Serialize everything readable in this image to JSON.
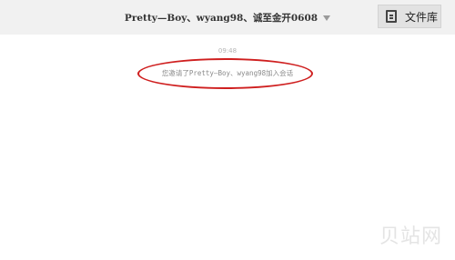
{
  "header": {
    "chat_title": "Pretty—Boy、wyang98、诚至金开0608",
    "files_button_label": "文件库"
  },
  "conversation": {
    "timestamp": "09:48",
    "system_message": "您邀请了Pretty—Boy、wyang98加入会话"
  },
  "watermark": "贝站网",
  "colors": {
    "header_bg": "#f1f1f1",
    "annotation_red": "#cf1f1f"
  },
  "icons": {
    "chevron": "chevron-down-icon",
    "files": "document-icon"
  }
}
